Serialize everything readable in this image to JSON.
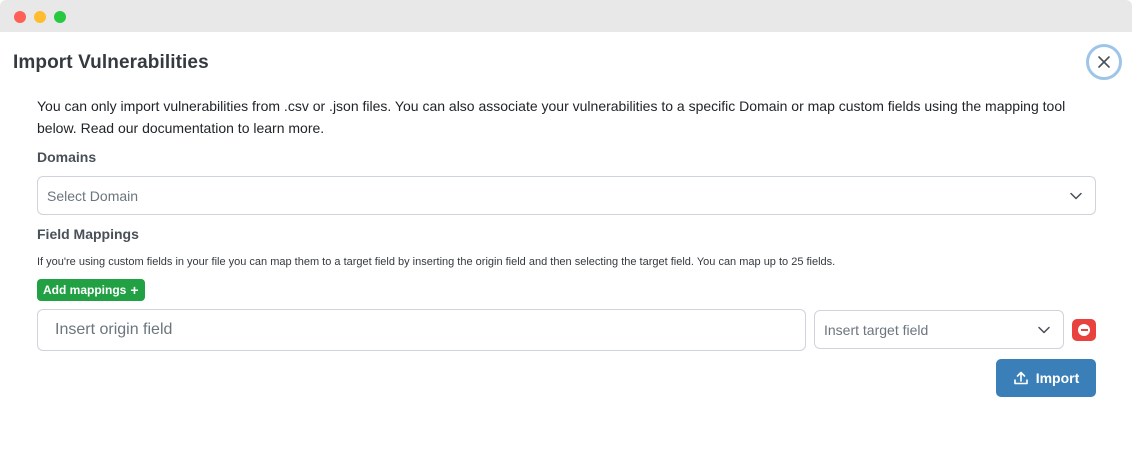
{
  "modal": {
    "title": "Import Vulnerabilities",
    "description": "You can only import vulnerabilities from .csv or .json files. You can also associate your vulnerabilities to a specific Domain or map custom fields using the mapping tool below. Read our documentation to learn more."
  },
  "domains": {
    "label": "Domains",
    "select_value": "Select Domain"
  },
  "field_mappings": {
    "label": "Field Mappings",
    "hint": "If you're using custom fields in your file you can map them to a target field by inserting the origin field and then selecting the target field. You can map up to 25 fields.",
    "add_button": "Add mappings",
    "add_icon": "+",
    "origin_placeholder": "Insert origin field",
    "target_value": "Insert target field"
  },
  "actions": {
    "import_label": "Import"
  },
  "colors": {
    "add_button": "#22a044",
    "import_button": "#3a7fb8",
    "remove_button": "#e8413e",
    "close_ring": "#9ec5e8"
  },
  "icons": {
    "close": "close-icon",
    "chevron": "chevron-down-icon",
    "remove": "minus-circle-icon",
    "import": "upload-icon"
  }
}
